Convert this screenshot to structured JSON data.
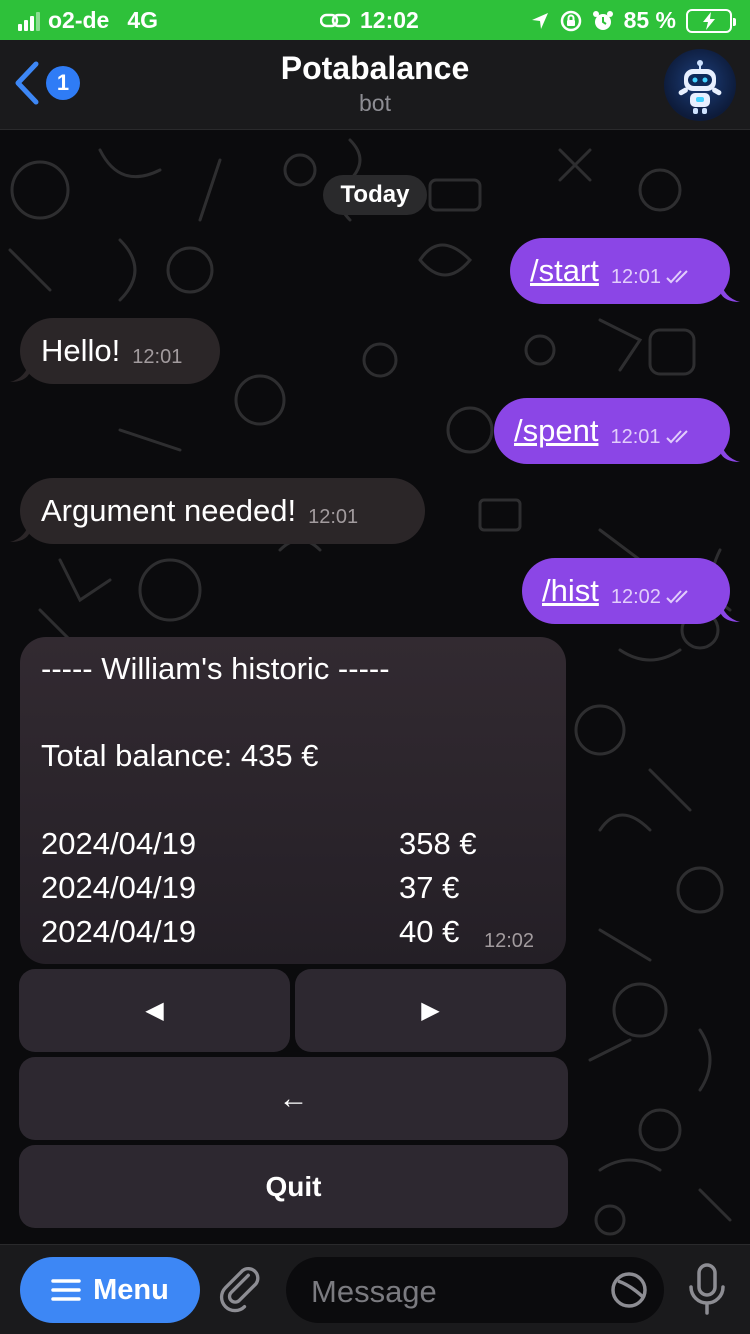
{
  "status_bar": {
    "carrier": "o2-de",
    "network": "4G",
    "time": "12:02",
    "battery_percent": "85 %"
  },
  "header": {
    "back_count": "1",
    "title": "Potabalance",
    "subtitle": "bot"
  },
  "chat": {
    "date_label": "Today",
    "messages": [
      {
        "text": "/start",
        "time": "12:01",
        "direction": "out"
      },
      {
        "text": "Hello!",
        "time": "12:01",
        "direction": "in"
      },
      {
        "text": "/spent",
        "time": "12:01",
        "direction": "out"
      },
      {
        "text": "Argument needed!",
        "time": "12:01",
        "direction": "in"
      },
      {
        "text": "/hist",
        "time": "12:02",
        "direction": "out"
      }
    ],
    "history": {
      "heading": "----- William's historic -----",
      "total": "Total balance: 435 €",
      "rows": [
        {
          "date": "2024/04/19",
          "amount": "358 €"
        },
        {
          "date": "2024/04/19",
          "amount": "37 €"
        },
        {
          "date": "2024/04/19",
          "amount": "40 €"
        }
      ],
      "time": "12:02"
    },
    "keyboard": {
      "prev": "◀",
      "next": "▶",
      "back": "←",
      "quit": "Quit"
    }
  },
  "input_bar": {
    "menu_label": "Menu",
    "placeholder": "Message"
  },
  "colors": {
    "status_green": "#2ec13a",
    "outgoing_bubble": "#8b46e6",
    "incoming_bubble": "#2b2628",
    "accent_blue": "#3d87f5"
  }
}
